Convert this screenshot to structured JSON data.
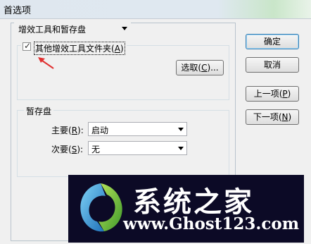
{
  "window": {
    "title": "首选项"
  },
  "section_select": {
    "value": "增效工具和暂存盘"
  },
  "plugins": {
    "checkbox_label_prefix": "其他增效工具文件夹(",
    "checkbox_label_key": "A",
    "checkbox_label_suffix": ")",
    "checked": true,
    "choose_prefix": "选取(",
    "choose_key": "C",
    "choose_suffix": ")..."
  },
  "scratch": {
    "group_label": "暂存盘",
    "primary_prefix": "主要(",
    "primary_key": "R",
    "primary_suffix": "):",
    "primary_value": "启动",
    "secondary_prefix": "次要(",
    "secondary_key": "S",
    "secondary_suffix": "):",
    "secondary_value": "无"
  },
  "buttons": {
    "ok": "确定",
    "cancel": "取消",
    "prev_prefix": "上一项(",
    "prev_key": "P",
    "prev_suffix": ")",
    "next_prefix": "下一项(",
    "next_key": "N",
    "next_suffix": ")"
  },
  "watermark": {
    "title": "系统之家",
    "url": "www.Ghost123.com"
  },
  "colors": {
    "arrow": "#e03030",
    "watermark_bg": "#0c0a26"
  }
}
